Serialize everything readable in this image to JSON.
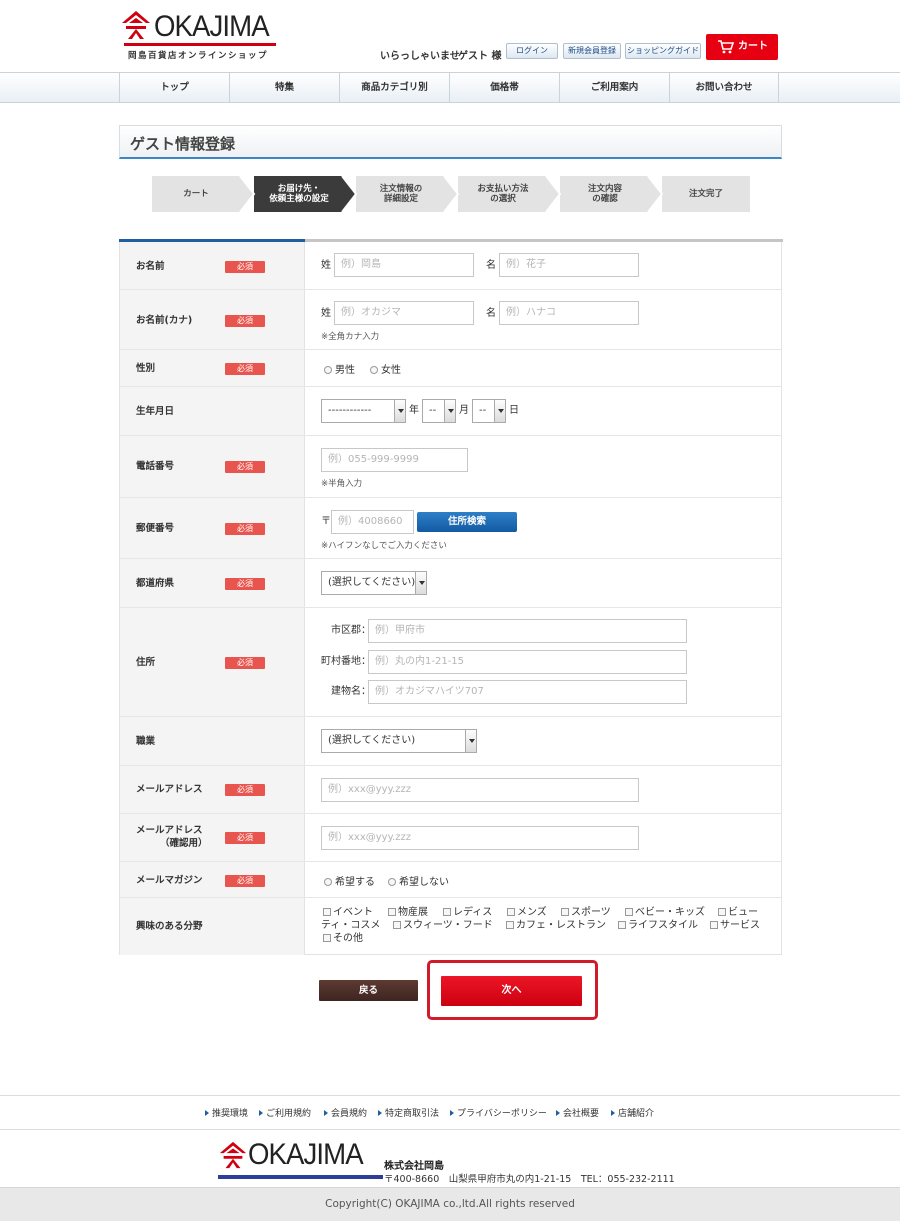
{
  "header": {
    "logo_text": "OKAJIMA",
    "logo_sub": "岡島百貨店オンラインショップ",
    "welcome": "いらっしゃいませ",
    "guest": "ゲスト 様",
    "login": "ログイン",
    "register": "新規会員登録",
    "guide": "ショッピングガイド",
    "cart": "カート"
  },
  "nav": [
    "トップ",
    "特集",
    "商品カテゴリ別",
    "価格帯",
    "ご利用案内",
    "お問い合わせ"
  ],
  "page_title": "ゲスト情報登録",
  "steps": [
    {
      "label": "カート",
      "active": false
    },
    {
      "label": "お届け先・\n依頼主様の設定",
      "active": true
    },
    {
      "label": "注文情報の\n詳細設定",
      "active": false
    },
    {
      "label": "お支払い方法\nの選択",
      "active": false
    },
    {
      "label": "注文内容\nの確認",
      "active": false
    },
    {
      "label": "注文完了",
      "active": false
    }
  ],
  "required_label": "必須",
  "form": {
    "name": {
      "label": "お名前",
      "sei": "姓",
      "mei": "名",
      "sei_ph": "例）岡島",
      "mei_ph": "例）花子"
    },
    "kana": {
      "label": "お名前(カナ)",
      "sei": "姓",
      "mei": "名",
      "sei_ph": "例）オカジマ",
      "mei_ph": "例）ハナコ",
      "note": "※全角カナ入力"
    },
    "gender": {
      "label": "性別",
      "male": "男性",
      "female": "女性"
    },
    "birth": {
      "label": "生年月日",
      "year_val": "------------",
      "year_unit": "年",
      "month_val": "--",
      "month_unit": "月",
      "day_val": "--",
      "day_unit": "日"
    },
    "phone": {
      "label": "電話番号",
      "ph": "例）055-999-9999",
      "note": "※半角入力"
    },
    "zip": {
      "label": "郵便番号",
      "mark": "〒",
      "ph": "例）4008660",
      "button": "住所検索",
      "note": "※ハイフンなしでご入力ください"
    },
    "pref": {
      "label": "都道府県",
      "value": "(選択してください)"
    },
    "address": {
      "label": "住所",
      "city": "市区郡：",
      "city_ph": "例）甲府市",
      "town": "町村番地：",
      "town_ph": "例）丸の内1-21-15",
      "bldg": "建物名：",
      "bldg_ph": "例）オカジマハイツ707"
    },
    "job": {
      "label": "職業",
      "value": "(選択してください)"
    },
    "email": {
      "label": "メールアドレス",
      "ph": "例）xxx@yyy.zzz"
    },
    "email2": {
      "label1": "メールアドレス",
      "label2": "（確認用）",
      "ph": "例）xxx@yyy.zzz"
    },
    "magazine": {
      "label": "メールマガジン",
      "yes": "希望する",
      "no": "希望しない"
    },
    "interest": {
      "label": "興味のある分野",
      "options": [
        "イベント",
        "物産展",
        "レディス",
        "メンズ",
        "スポーツ",
        "ベビー・キッズ",
        "ビュー",
        "ティ・コスメ",
        "スウィーツ・フード",
        "カフェ・レストラン",
        "ライフスタイル",
        "サービス",
        "その他"
      ]
    }
  },
  "buttons": {
    "back": "戻る",
    "next": "次へ"
  },
  "footer": {
    "links": [
      "推奨環境",
      "ご利用規約",
      "会員規約",
      "特定商取引法",
      "プライバシーポリシー",
      "会社概要",
      "店舗紹介"
    ],
    "logo_text": "OKAJIMA",
    "company": "株式会社岡島",
    "address": "〒400-8660　山梨県甲府市丸の内1-21-15　TEL：055-232-2111",
    "copyright": "Copyright(C) OKAJIMA co.,ltd.All rights reserved"
  },
  "colors": {
    "accent_red": "#e60012",
    "accent_blue": "#1f5fa0",
    "required": "#e8554e",
    "brand_navy": "#2b3f9a"
  }
}
